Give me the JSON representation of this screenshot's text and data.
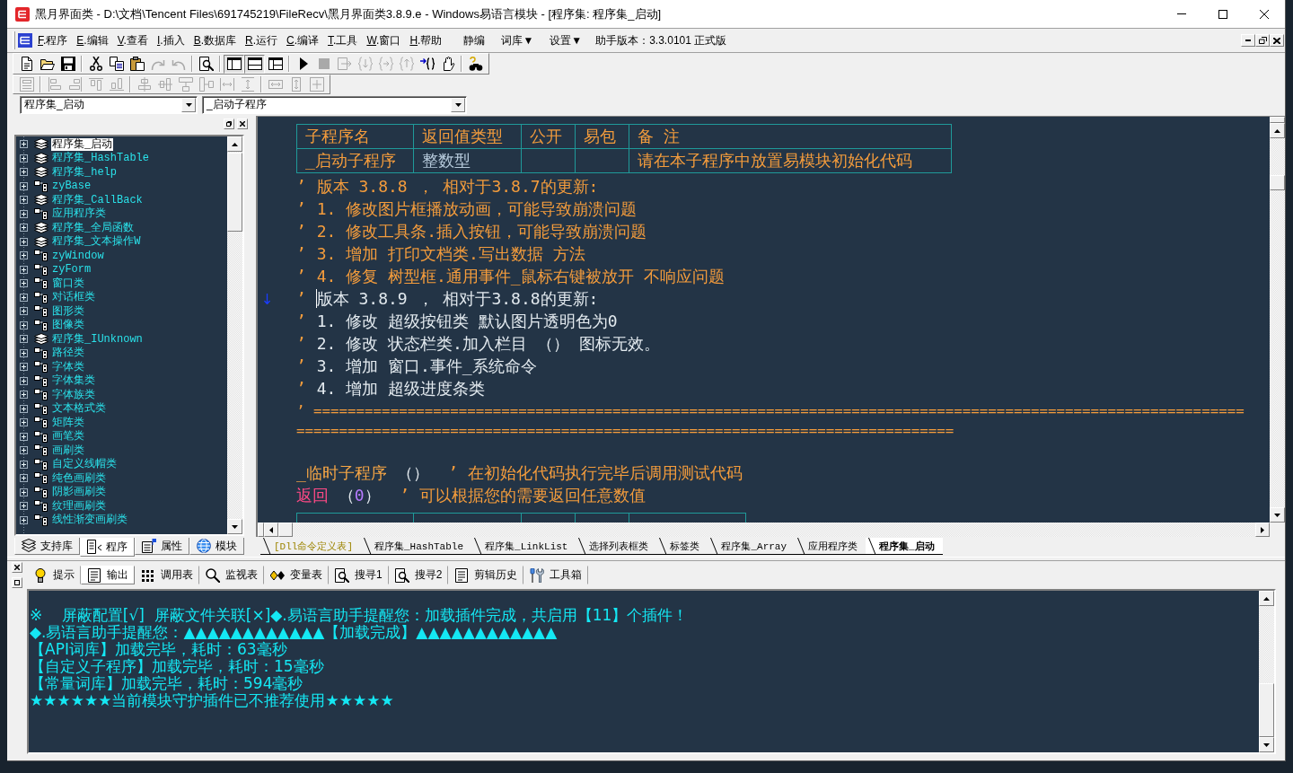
{
  "window": {
    "title": "黑月界面类 - D:\\文档\\Tencent Files\\691745219\\FileRecv\\黑月界面类3.8.9.e - Windows易语言模块 - [程序集: 程序集_启动]"
  },
  "menu": {
    "items": [
      {
        "key": "F",
        "label": ".程序"
      },
      {
        "key": "E",
        "label": ".编辑"
      },
      {
        "key": "V",
        "label": ".查看"
      },
      {
        "key": "I",
        "label": ".插入"
      },
      {
        "key": "B",
        "label": ".数据库"
      },
      {
        "key": "R",
        "label": ".运行"
      },
      {
        "key": "C",
        "label": ".编译"
      },
      {
        "key": "T",
        "label": ".工具"
      },
      {
        "key": "W",
        "label": ".窗口"
      },
      {
        "key": "H",
        "label": ".帮助"
      }
    ],
    "extras": [
      "静编",
      "词库▼",
      "设置▼"
    ],
    "version": "助手版本：3.3.0101 正式版"
  },
  "toolbar_1": [
    {
      "disabled": false,
      "pressed": false
    },
    {
      "disabled": false,
      "pressed": false
    },
    {
      "disabled": false,
      "pressed": false
    },
    {
      "disabled": false,
      "pressed": false
    },
    {
      "disabled": false,
      "pressed": false
    },
    {
      "disabled": false,
      "pressed": false
    },
    {
      "disabled": true,
      "pressed": false
    },
    {
      "disabled": true,
      "pressed": false
    },
    {
      "disabled": false,
      "pressed": false
    },
    {
      "disabled": false,
      "pressed": true
    },
    {
      "disabled": false,
      "pressed": true
    },
    {
      "disabled": false,
      "pressed": false
    },
    {
      "disabled": false,
      "pressed": false
    },
    {
      "disabled": true,
      "pressed": false
    },
    {
      "disabled": true,
      "pressed": false
    },
    {
      "disabled": true,
      "pressed": false
    },
    {
      "disabled": true,
      "pressed": false
    },
    {
      "disabled": true,
      "pressed": false
    },
    {
      "disabled": false,
      "pressed": false
    },
    {
      "disabled": false,
      "pressed": false
    },
    {
      "disabled": false,
      "pressed": false
    }
  ],
  "toolbar_2": [
    {
      "disabled": true
    },
    {
      "disabled": true
    },
    {
      "disabled": true
    },
    {
      "disabled": true
    },
    {
      "disabled": true
    },
    {
      "disabled": true
    },
    {
      "disabled": true
    },
    {
      "disabled": true
    },
    {
      "disabled": true
    },
    {
      "disabled": true
    },
    {
      "disabled": true
    },
    {
      "disabled": true
    },
    {
      "disabled": true
    },
    {
      "disabled": true
    }
  ],
  "selectors": [
    {
      "value": "程序集_启动"
    },
    {
      "value": "_启动子程序"
    }
  ],
  "sidebar": {
    "items": [
      {
        "label": "程序集_启动",
        "kind": "assembly",
        "expanded": false,
        "selected": true
      },
      {
        "label": "程序集_HashTable",
        "kind": "assembly",
        "expanded": false,
        "selected": false
      },
      {
        "label": "程序集_help",
        "kind": "assembly",
        "expanded": false,
        "selected": false
      },
      {
        "label": "zyBase",
        "kind": "class",
        "expanded": false,
        "selected": false
      },
      {
        "label": "程序集_CallBack",
        "kind": "assembly",
        "expanded": false,
        "selected": false
      },
      {
        "label": "应用程序类",
        "kind": "class",
        "expanded": false,
        "selected": false
      },
      {
        "label": "程序集_全局函数",
        "kind": "assembly",
        "expanded": false,
        "selected": false
      },
      {
        "label": "程序集_文本操作W",
        "kind": "assembly",
        "expanded": false,
        "selected": false
      },
      {
        "label": "zyWindow",
        "kind": "class",
        "expanded": false,
        "selected": false
      },
      {
        "label": "zyForm",
        "kind": "class",
        "expanded": false,
        "selected": false
      },
      {
        "label": "窗口类",
        "kind": "class",
        "expanded": false,
        "selected": false
      },
      {
        "label": "对话框类",
        "kind": "class",
        "expanded": false,
        "selected": false
      },
      {
        "label": "图形类",
        "kind": "class",
        "expanded": false,
        "selected": false
      },
      {
        "label": "图像类",
        "kind": "class",
        "expanded": false,
        "selected": false
      },
      {
        "label": "程序集_IUnknown",
        "kind": "assembly",
        "expanded": false,
        "selected": false
      },
      {
        "label": "路径类",
        "kind": "class",
        "expanded": false,
        "selected": false
      },
      {
        "label": "字体类",
        "kind": "class",
        "expanded": false,
        "selected": false
      },
      {
        "label": "字体集类",
        "kind": "class",
        "expanded": false,
        "selected": false
      },
      {
        "label": "字体族类",
        "kind": "class",
        "expanded": false,
        "selected": false
      },
      {
        "label": "文本格式类",
        "kind": "class",
        "expanded": false,
        "selected": false
      },
      {
        "label": "矩阵类",
        "kind": "class",
        "expanded": false,
        "selected": false
      },
      {
        "label": "画笔类",
        "kind": "class",
        "expanded": false,
        "selected": false
      },
      {
        "label": "画刷类",
        "kind": "class",
        "expanded": false,
        "selected": false
      },
      {
        "label": "自定义线帽类",
        "kind": "class",
        "expanded": false,
        "selected": false
      },
      {
        "label": "纯色画刷类",
        "kind": "class",
        "expanded": false,
        "selected": false
      },
      {
        "label": "阴影画刷类",
        "kind": "class",
        "expanded": false,
        "selected": false
      },
      {
        "label": "纹理画刷类",
        "kind": "class",
        "expanded": false,
        "selected": false
      },
      {
        "label": "线性渐变画刷类",
        "kind": "class",
        "expanded": false,
        "selected": false
      }
    ],
    "tabs": [
      {
        "label": "支持库",
        "selected": false
      },
      {
        "label": "程序",
        "selected": true
      },
      {
        "label": "属性",
        "selected": false
      },
      {
        "label": "模块",
        "selected": false
      }
    ]
  },
  "editor": {
    "table": {
      "columns": [
        "子程序名",
        "返回值类型",
        "公开",
        "易包",
        "备 注"
      ],
      "row": {
        "name": "_启动子程序",
        "return_type": "整数型",
        "note": "请在本子程序中放置易模块初始化代码"
      }
    },
    "notes": [
      {
        "kind": "comment",
        "mark": "’",
        "text": "版本 3.8.8 ， 相对于3.8.7的更新:",
        "current": false
      },
      {
        "kind": "comment",
        "mark": "’",
        "text": "1. 修改图片框播放动画，可能导致崩溃问题",
        "current": false
      },
      {
        "kind": "comment",
        "mark": "’",
        "text": "2. 修改工具条.插入按钮，可能导致崩溃问题",
        "current": false
      },
      {
        "kind": "comment",
        "mark": "’",
        "text": "3. 增加 打印文档类.写出数据 方法",
        "current": false
      },
      {
        "kind": "comment",
        "mark": "’",
        "text": "4. 修复 树型框.通用事件_鼠标右键被放开 不响应问题",
        "current": false
      },
      {
        "kind": "text",
        "mark": "’",
        "text": "版本 3.8.9 ， 相对于3.8.8的更新:",
        "current": true
      },
      {
        "kind": "text",
        "mark": "’",
        "text": "1. 修改 超级按钮类 默认图片透明色为0",
        "current": false
      },
      {
        "kind": "text",
        "mark": "’",
        "text": "2. 修改 状态栏类.加入栏目 （） 图标无效。",
        "current": false
      },
      {
        "kind": "text",
        "mark": "’",
        "text": "3. 增加 窗口.事件_系统命令",
        "current": false
      },
      {
        "kind": "text",
        "mark": "’",
        "text": "4. 增加 超级进度条类",
        "current": false
      }
    ],
    "rules": [
      {
        "mark": "’",
        "text": "============================================================================================================="
      },
      {
        "text": "============================================================================="
      }
    ],
    "code": [
      {
        "tokens": [
          {
            "kind": "name",
            "text": "_临时子程序"
          },
          {
            "kind": "paren",
            "text": " （）"
          },
          {
            "kind": "comment",
            "text": "  ’ 在初始化代码执行完毕后调用测试代码"
          }
        ]
      },
      {
        "tokens": [
          {
            "kind": "keyword",
            "text": "返回"
          },
          {
            "kind": "paren",
            "text": " （"
          },
          {
            "kind": "number",
            "text": "0"
          },
          {
            "kind": "paren",
            "text": "）"
          },
          {
            "kind": "comment",
            "text": "  ’ 可以根据您的需要返回任意数值"
          }
        ]
      }
    ]
  },
  "file_tabs": [
    {
      "label": "[Dll命令定义表]",
      "kind": "dll",
      "selected": false
    },
    {
      "label": "程序集_HashTable",
      "kind": "code",
      "selected": false
    },
    {
      "label": "程序集_LinkList",
      "kind": "code",
      "selected": false
    },
    {
      "label": "选择列表框类",
      "kind": "code",
      "selected": false
    },
    {
      "label": "标签类",
      "kind": "code",
      "selected": false
    },
    {
      "label": "程序集_Array",
      "kind": "code",
      "selected": false
    },
    {
      "label": "应用程序类",
      "kind": "code",
      "selected": false
    },
    {
      "label": "程序集_启动",
      "kind": "code",
      "selected": true
    }
  ],
  "output": {
    "tabs": [
      {
        "label": "提示",
        "selected": false
      },
      {
        "label": "输出",
        "selected": true
      },
      {
        "label": "调用表",
        "selected": false
      },
      {
        "label": "监视表",
        "selected": false
      },
      {
        "label": "变量表",
        "selected": false
      },
      {
        "label": "搜寻1",
        "selected": false
      },
      {
        "label": "搜寻2",
        "selected": false
      },
      {
        "label": "剪辑历史",
        "selected": false
      },
      {
        "label": "工具箱",
        "selected": false
      }
    ],
    "lines": [
      "※    屏蔽配置[√]  屏蔽文件关联[×]◆.易语言助手提醒您：加载插件完成，共启用【11】个插件！",
      "◆.易语言助手提醒您：▲▲▲▲▲▲▲▲▲▲▲▲【加载完成】▲▲▲▲▲▲▲▲▲▲▲▲",
      "【API词库】加载完毕，耗时：63毫秒",
      "【自定义子程序】加载完毕，耗时：15毫秒",
      "【常量词库】加载完毕，耗时：594毫秒",
      "★★★★★★当前模块守护插件已不推荐使用★★★★★"
    ]
  }
}
